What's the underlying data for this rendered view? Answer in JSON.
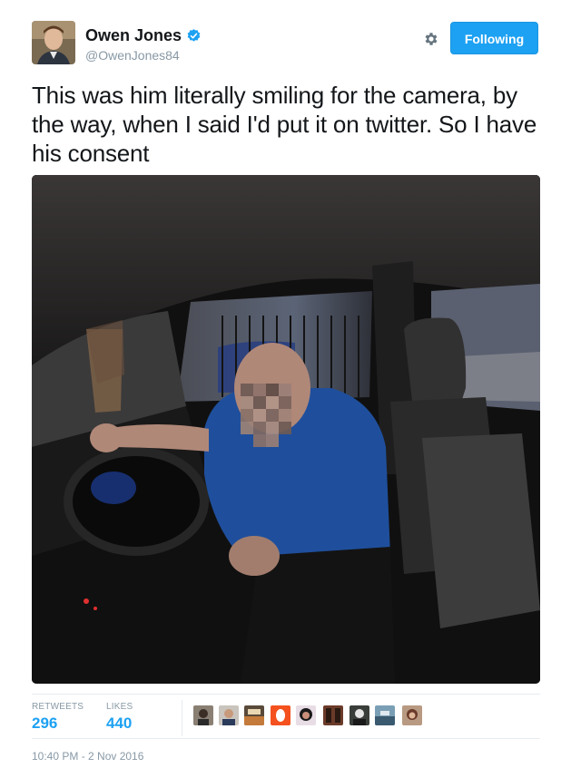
{
  "user": {
    "name": "Owen Jones",
    "handle": "@OwenJones84",
    "verified_icon": "verified-badge-icon"
  },
  "header": {
    "follow_button_label": "Following",
    "settings_icon": "gear-icon"
  },
  "tweet": {
    "text": "This was him literally smiling for the camera, by the way, when I said I'd put it on twitter. So I have his consent",
    "timestamp": "10:40 PM - 2 Nov 2016"
  },
  "stats": {
    "retweets_label": "RETWEETS",
    "retweets_value": "296",
    "likes_label": "LIKES",
    "likes_value": "440"
  },
  "colors": {
    "accent": "#1da1f2",
    "muted": "#8899a6",
    "text": "#14171a"
  }
}
